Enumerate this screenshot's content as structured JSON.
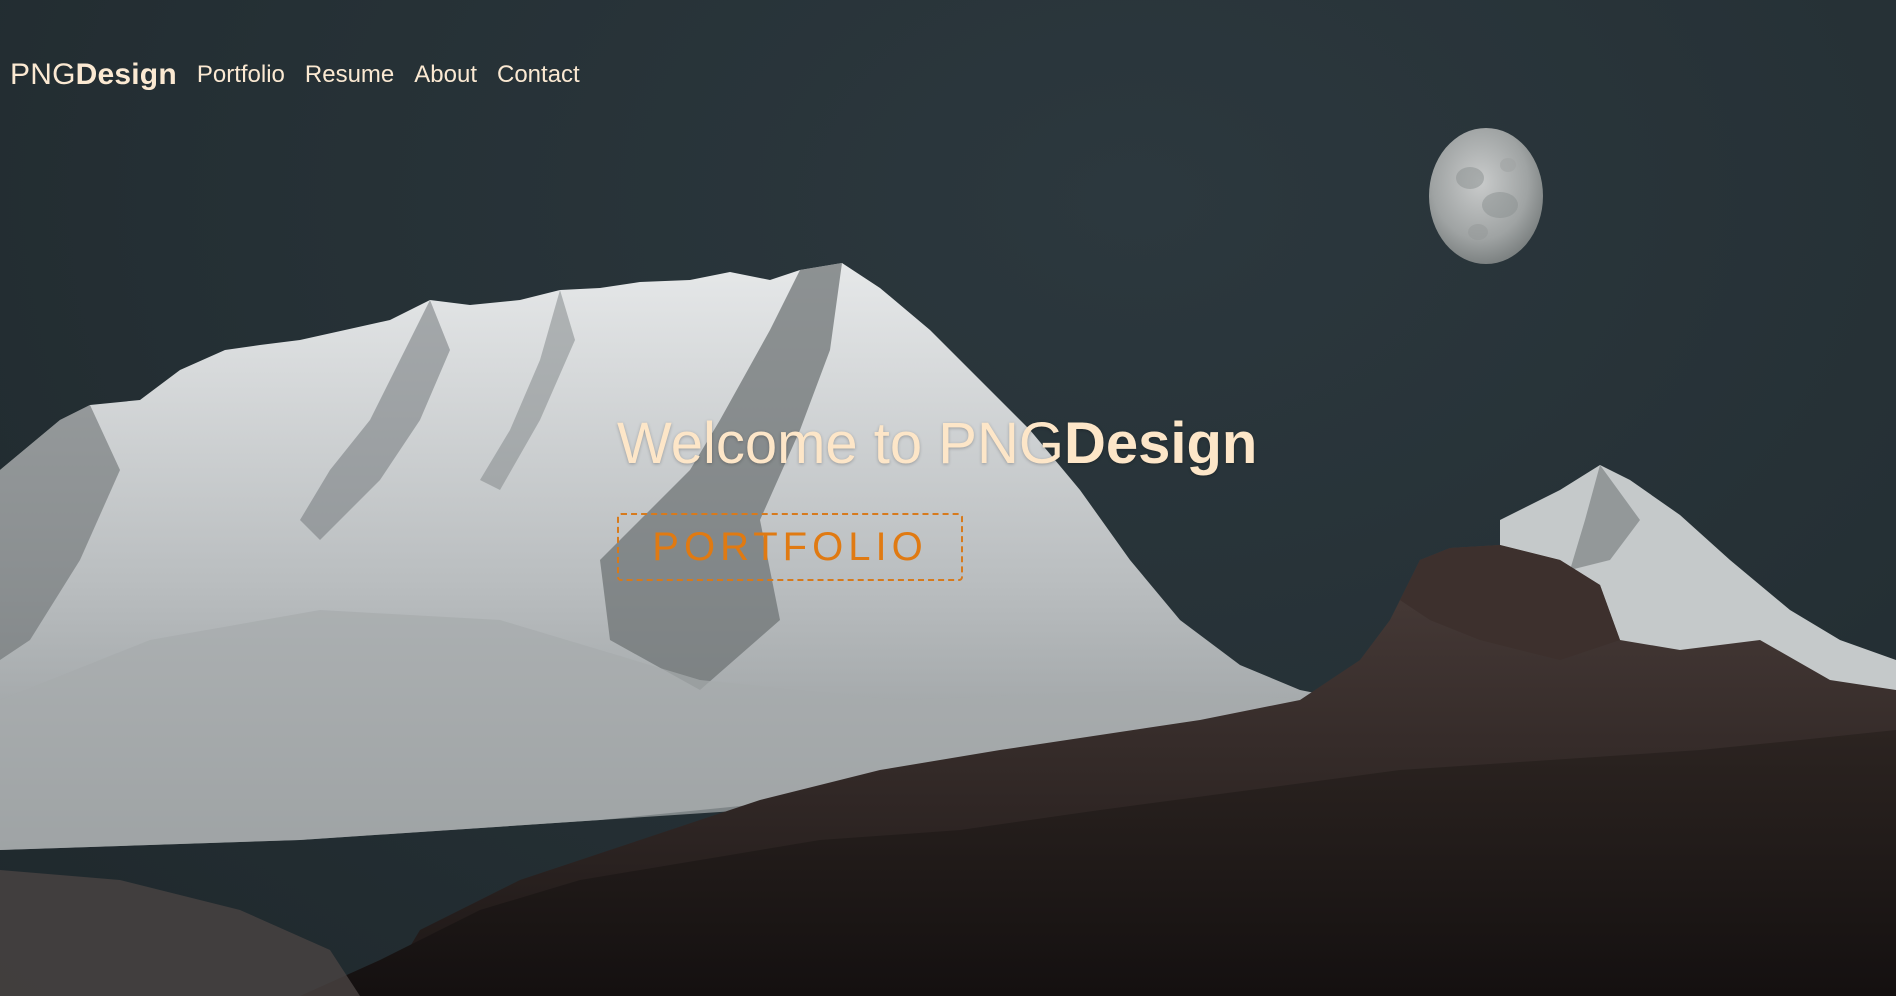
{
  "nav": {
    "brand_light": "PNG",
    "brand_bold": "Design",
    "links": [
      "Portfolio",
      "Resume",
      "About",
      "Contact"
    ]
  },
  "hero": {
    "headline_light": "Welcome to PNG",
    "headline_bold": "Design",
    "cta_label": "PORTFOLIO"
  },
  "colors": {
    "text_cream": "#fbe9d2",
    "accent_orange": "#e07a12",
    "sky": "#263036"
  }
}
